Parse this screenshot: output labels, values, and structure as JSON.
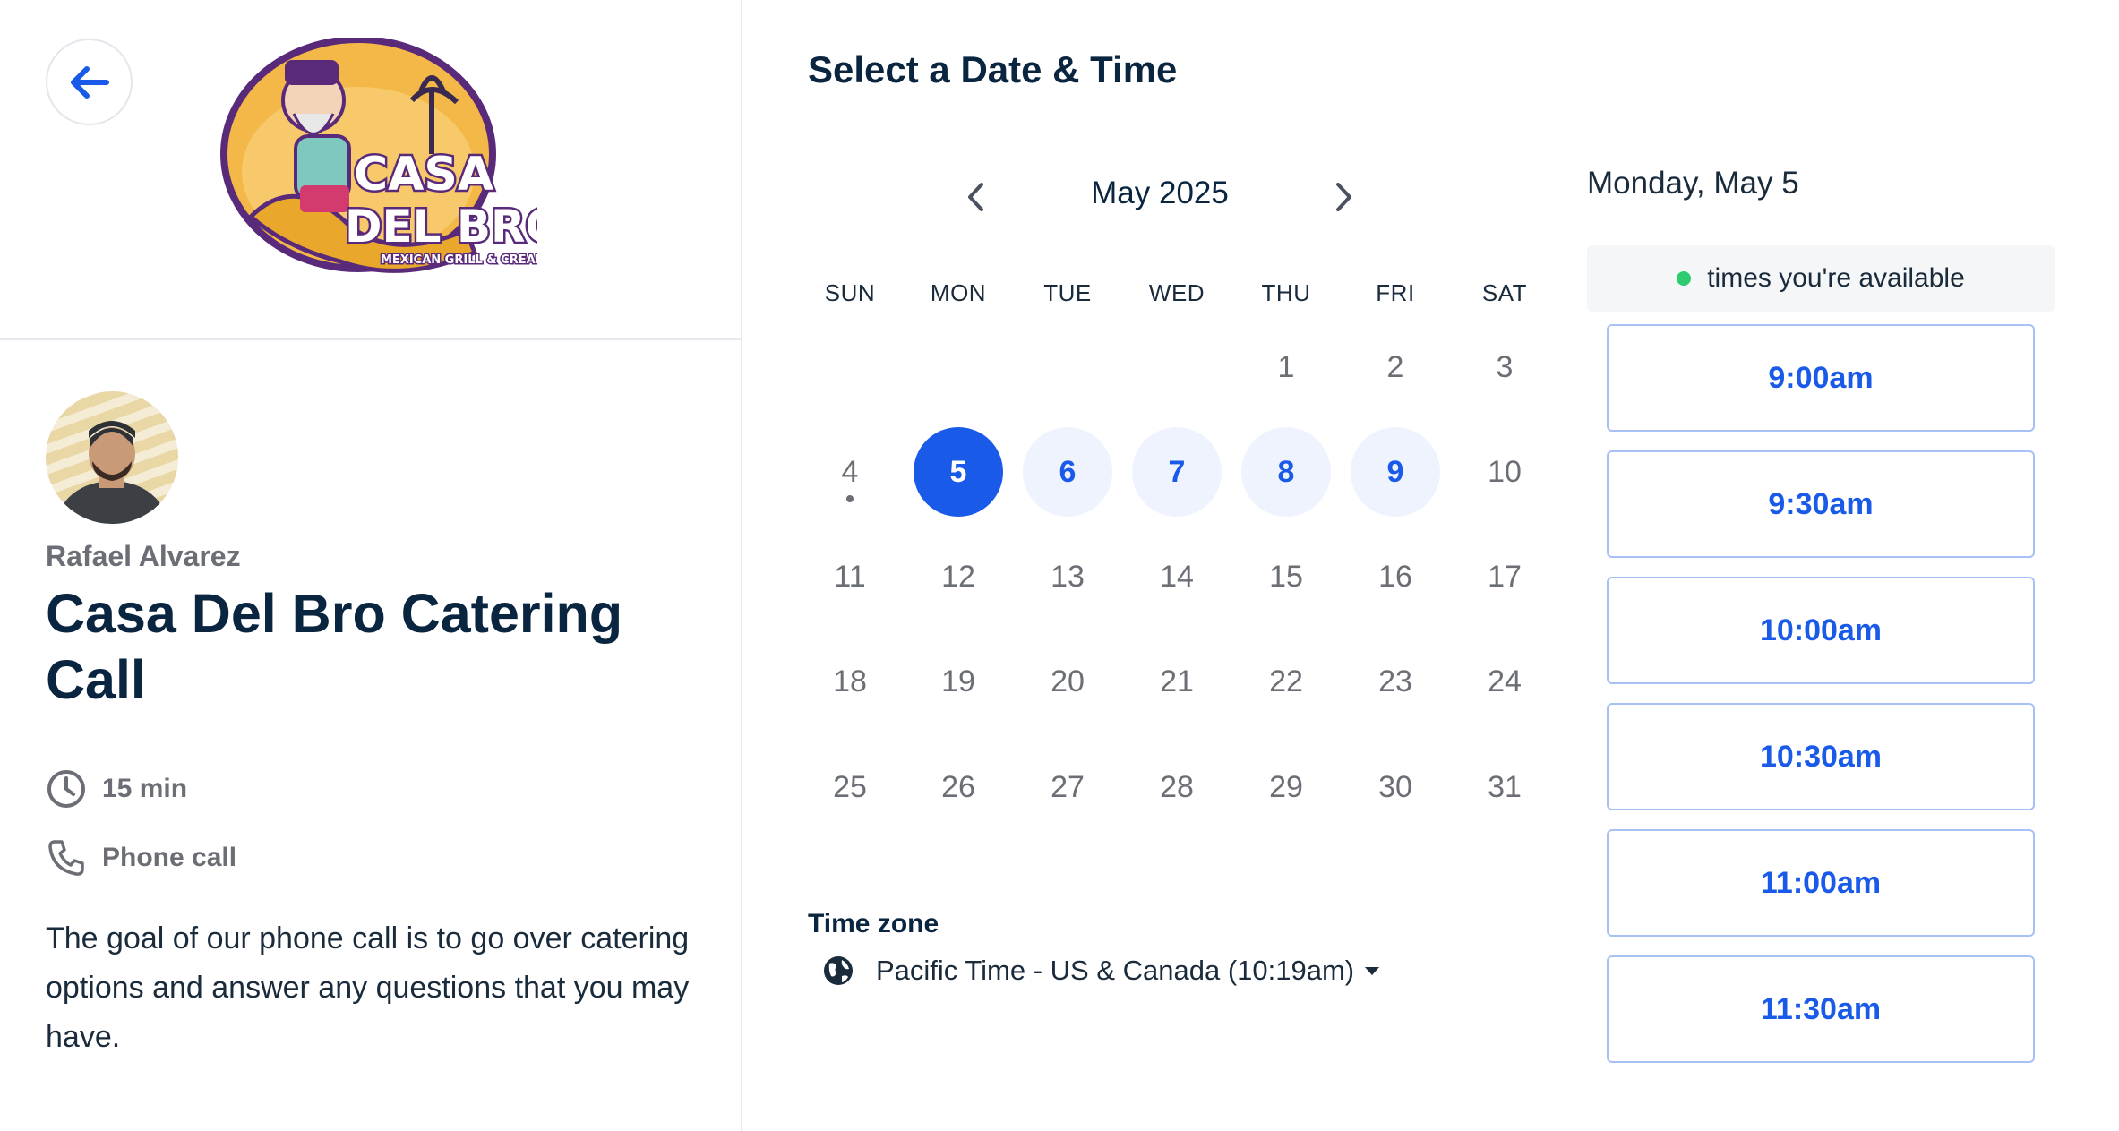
{
  "colors": {
    "accent": "#1a5ae8",
    "available_bg": "#eef3fe",
    "available_dot": "#2ecc71",
    "text_dark": "#0a2540",
    "text_muted": "#6b6f75"
  },
  "left": {
    "back_icon": "arrow-left-icon",
    "logo_text": {
      "line1": "CASA",
      "line2": "DEL BRO",
      "tagline": "MEXICAN GRILL & CREAMERY"
    },
    "host_name": "Rafael Alvarez",
    "event_title": "Casa Del Bro Catering Call",
    "duration": "15 min",
    "location": "Phone call",
    "description": "The goal of our phone call is to go over catering options and answer any questions that you may have."
  },
  "calendar": {
    "heading": "Select a Date & Time",
    "month_label": "May 2025",
    "weekdays": [
      "SUN",
      "MON",
      "TUE",
      "WED",
      "THU",
      "FRI",
      "SAT"
    ],
    "days": [
      {
        "n": "1",
        "col": 4,
        "row": 0,
        "state": "default"
      },
      {
        "n": "2",
        "col": 5,
        "row": 0,
        "state": "default"
      },
      {
        "n": "3",
        "col": 6,
        "row": 0,
        "state": "default"
      },
      {
        "n": "4",
        "col": 0,
        "row": 1,
        "state": "today"
      },
      {
        "n": "5",
        "col": 1,
        "row": 1,
        "state": "selected"
      },
      {
        "n": "6",
        "col": 2,
        "row": 1,
        "state": "available"
      },
      {
        "n": "7",
        "col": 3,
        "row": 1,
        "state": "available"
      },
      {
        "n": "8",
        "col": 4,
        "row": 1,
        "state": "available"
      },
      {
        "n": "9",
        "col": 5,
        "row": 1,
        "state": "available"
      },
      {
        "n": "10",
        "col": 6,
        "row": 1,
        "state": "default"
      },
      {
        "n": "11",
        "col": 0,
        "row": 2,
        "state": "default"
      },
      {
        "n": "12",
        "col": 1,
        "row": 2,
        "state": "default"
      },
      {
        "n": "13",
        "col": 2,
        "row": 2,
        "state": "default"
      },
      {
        "n": "14",
        "col": 3,
        "row": 2,
        "state": "default"
      },
      {
        "n": "15",
        "col": 4,
        "row": 2,
        "state": "default"
      },
      {
        "n": "16",
        "col": 5,
        "row": 2,
        "state": "default"
      },
      {
        "n": "17",
        "col": 6,
        "row": 2,
        "state": "default"
      },
      {
        "n": "18",
        "col": 0,
        "row": 3,
        "state": "default"
      },
      {
        "n": "19",
        "col": 1,
        "row": 3,
        "state": "default"
      },
      {
        "n": "20",
        "col": 2,
        "row": 3,
        "state": "default"
      },
      {
        "n": "21",
        "col": 3,
        "row": 3,
        "state": "default"
      },
      {
        "n": "22",
        "col": 4,
        "row": 3,
        "state": "default"
      },
      {
        "n": "23",
        "col": 5,
        "row": 3,
        "state": "default"
      },
      {
        "n": "24",
        "col": 6,
        "row": 3,
        "state": "default"
      },
      {
        "n": "25",
        "col": 0,
        "row": 4,
        "state": "default"
      },
      {
        "n": "26",
        "col": 1,
        "row": 4,
        "state": "default"
      },
      {
        "n": "27",
        "col": 2,
        "row": 4,
        "state": "default"
      },
      {
        "n": "28",
        "col": 3,
        "row": 4,
        "state": "default"
      },
      {
        "n": "29",
        "col": 4,
        "row": 4,
        "state": "default"
      },
      {
        "n": "30",
        "col": 5,
        "row": 4,
        "state": "default"
      },
      {
        "n": "31",
        "col": 6,
        "row": 4,
        "state": "default"
      }
    ]
  },
  "timezone": {
    "label": "Time zone",
    "value": "Pacific Time - US & Canada (10:19am)",
    "icon": "globe-icon"
  },
  "times": {
    "selected_date": "Monday, May 5",
    "legend": "times you're available",
    "slots": [
      "9:00am",
      "9:30am",
      "10:00am",
      "10:30am",
      "11:00am",
      "11:30am"
    ]
  }
}
